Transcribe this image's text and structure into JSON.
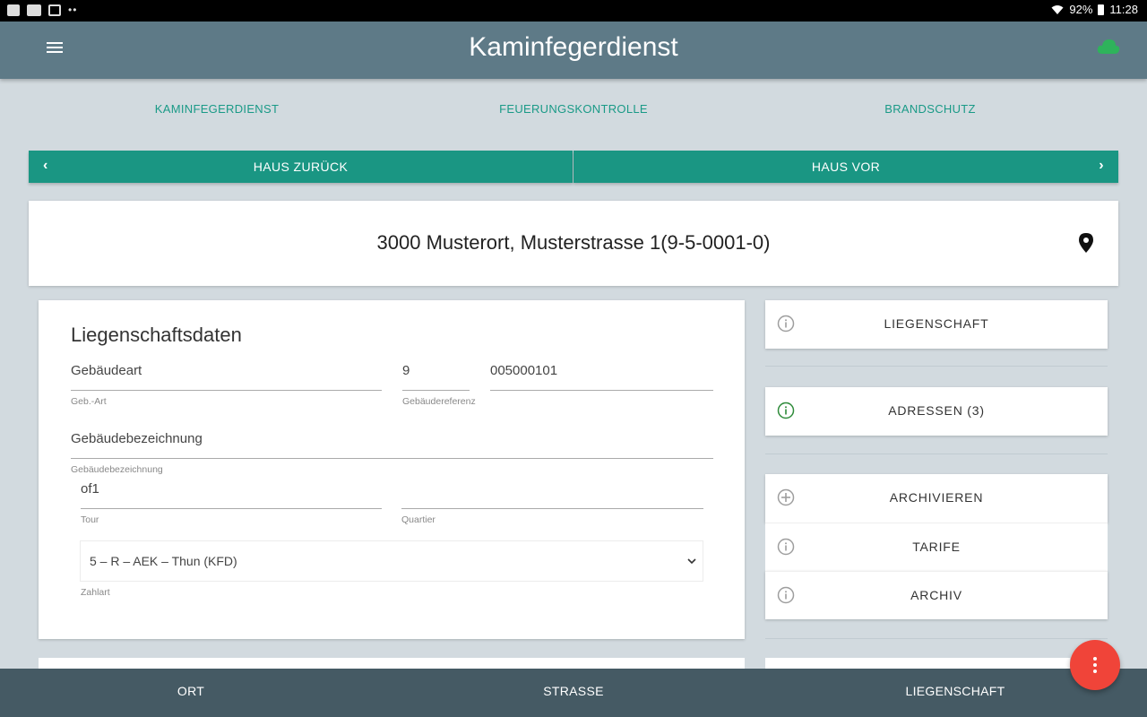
{
  "status_bar": {
    "battery": "92%",
    "time": "11:28",
    "left_icons": [
      "gallery-icon",
      "youtube-icon",
      "gmail-icon"
    ],
    "more_indicator": "••"
  },
  "app_bar": {
    "title": "Kaminfegerdienst",
    "menu_icon": "menu-icon",
    "sync_icon": "cloud-icon",
    "sync_color": "#2eb35b"
  },
  "top_tabs": [
    "KAMINFEGERDIENST",
    "FEUERUNGSKONTROLLE",
    "BRANDSCHUTZ"
  ],
  "nav": {
    "back_label": "HAUS ZURÜCK",
    "forward_label": "HAUS VOR"
  },
  "address": {
    "text": "3000 Musterort, Musterstrasse 1(9-5-0001-0)",
    "icon": "map-pin-icon"
  },
  "form": {
    "title": "Liegenschaftsdaten",
    "gebaeudeart": {
      "value": "Gebäudeart",
      "label": "Geb.-Art"
    },
    "gebaeudereferenz_nr": {
      "value": "9",
      "label": "Gebäudereferenz"
    },
    "gebaeudereferenz": {
      "value": "005000101"
    },
    "gebaeudebezeichnung": {
      "value": "Gebäudebezeichnung",
      "label": "Gebäudebezeichnung"
    },
    "tour": {
      "value": "of1",
      "label": "Tour"
    },
    "quartier": {
      "value": "",
      "label": "Quartier"
    },
    "zahlart": {
      "value": "5 – R – AEK – Thun (KFD)",
      "label": "Zahlart"
    }
  },
  "actions": [
    {
      "label": "LIEGENSCHAFT",
      "icon": "info-icon",
      "icon_color": "#9e9e9e"
    },
    {
      "label": "ADRESSEN (3)",
      "icon": "info-icon",
      "icon_color": "#2e8b3a"
    },
    {
      "label": "ARCHIVIEREN",
      "icon": "add-circle-icon",
      "icon_color": "#9e9e9e"
    },
    {
      "label": "TARIFE",
      "icon": "info-icon",
      "icon_color": "#9e9e9e"
    },
    {
      "label": "ARCHIV",
      "icon": "info-icon",
      "icon_color": "#9e9e9e"
    }
  ],
  "bottom_nav": [
    "ORT",
    "STRASSE",
    "LIEGENSCHAFT"
  ],
  "colors": {
    "app_bar": "#5e7a87",
    "accent": "#1a9683",
    "background": "#d2dadf",
    "bottom_nav": "#455a64",
    "fab": "#f04439"
  }
}
